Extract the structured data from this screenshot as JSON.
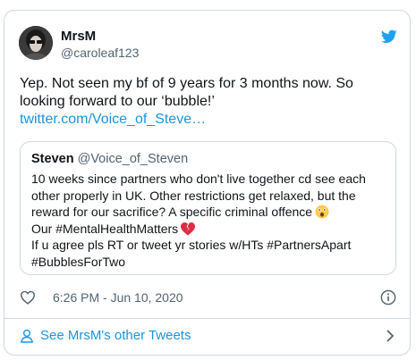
{
  "author": {
    "name": "MrsM",
    "handle": "@caroleaf123",
    "avatar_icon": "avatar-photo"
  },
  "tweet": {
    "text": "Yep. Not seen my bf of 9 years for 3 months now.  So looking forward to our ‘bubble!’",
    "link": "twitter.com/Voice_of_Steve…"
  },
  "quoted_tweet": {
    "name": "Steven",
    "handle": "@Voice_of_Steven",
    "line1": "10 weeks since partners who don't live together cd see each other properly in UK. Other restrictions get relaxed, but the reward for our sacrifice? A specific criminal offence",
    "line2": "Our #MentalHealthMatters",
    "line3": "If u agree pls RT or tweet yr stories w/HTs #PartnersApart #BubblesForTwo",
    "emoji1": "astonished-face-emoji",
    "emoji2": "broken-heart-emoji"
  },
  "meta": {
    "timestamp": "6:26 PM - Jun 10, 2020"
  },
  "footer": {
    "more_label": "See MrsM's other Tweets"
  },
  "colors": {
    "link": "#1b95e0",
    "twitter_blue": "#1da1f2",
    "text": "#0f1419",
    "secondary": "#536471",
    "border": "#cfd9de"
  }
}
